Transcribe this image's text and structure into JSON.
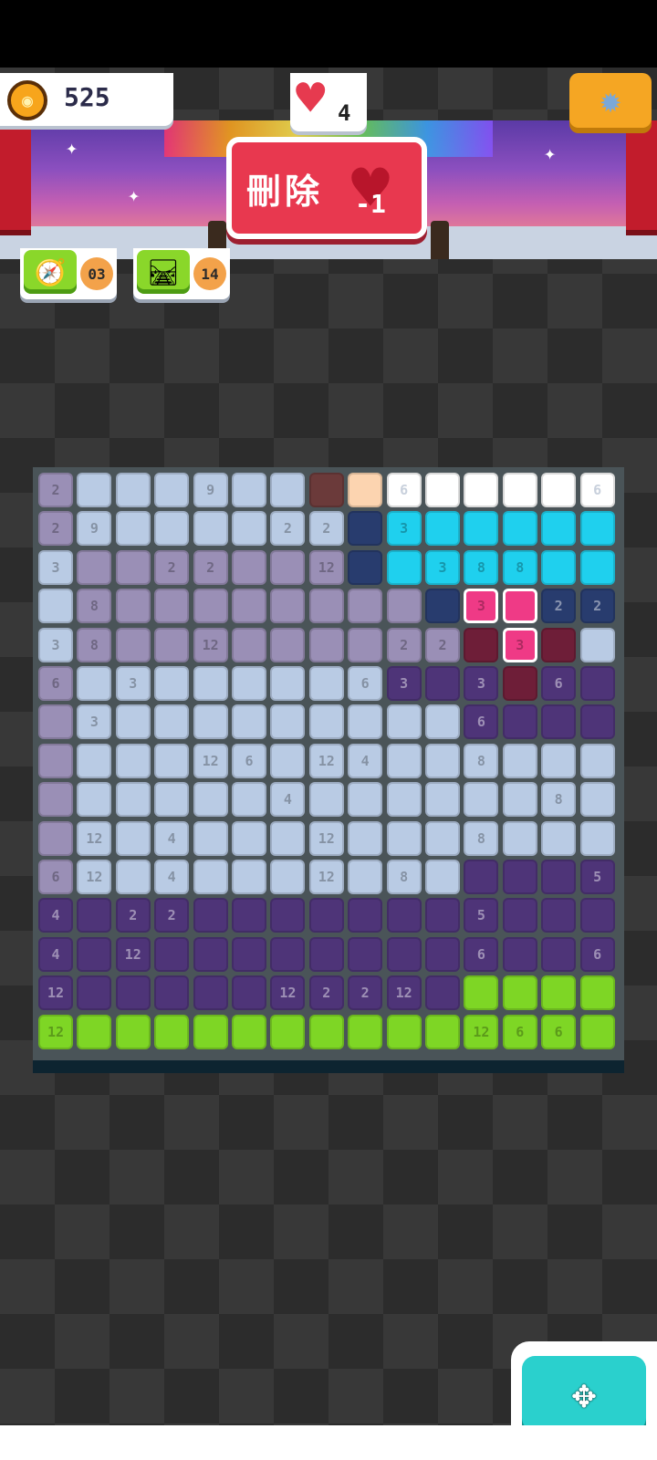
{
  "header": {
    "coins": "525",
    "lives": "4",
    "delete_label": "刪除",
    "delete_cost": "-1",
    "icons": {
      "coin": "coin-icon",
      "heart": "heart-icon",
      "settings": "gear-icon"
    }
  },
  "powerups": [
    {
      "icon": "compass-icon",
      "count": "03"
    },
    {
      "icon": "rail-icon",
      "count": "14"
    }
  ],
  "fab": {
    "icon": "move-arrows-icon"
  },
  "colors": {
    "L": "#b9cbe4",
    "P": "#9a8fb6",
    "D": "#4e3478",
    "G": "#7ed625",
    "C": "#1fd0ee",
    "N": "#283c6e",
    "K": "#ef3a86",
    "M": "#6e1e38",
    "B": "#6b3a3a",
    "E": "#fcd4b0",
    "W": "#ffffff"
  },
  "board": {
    "rows": [
      [
        "P",
        "L",
        "L",
        "L",
        "L",
        "L",
        "L",
        "B",
        "E",
        "W",
        "W",
        "W",
        "W",
        "W",
        "W"
      ],
      [
        "P",
        "L",
        "L",
        "L",
        "L",
        "L",
        "L",
        "L",
        "N",
        "C",
        "C",
        "C",
        "C",
        "C",
        "C"
      ],
      [
        "L",
        "P",
        "P",
        "P",
        "P",
        "P",
        "P",
        "P",
        "N",
        "C",
        "C",
        "C",
        "C",
        "C",
        "C"
      ],
      [
        "L",
        "P",
        "P",
        "P",
        "P",
        "P",
        "P",
        "P",
        "P",
        "P",
        "N",
        "K",
        "K",
        "N",
        "N"
      ],
      [
        "L",
        "P",
        "P",
        "P",
        "P",
        "P",
        "P",
        "P",
        "P",
        "P",
        "P",
        "M",
        "K",
        "M",
        "L"
      ],
      [
        "P",
        "L",
        "L",
        "L",
        "L",
        "L",
        "L",
        "L",
        "L",
        "D",
        "D",
        "D",
        "M",
        "D",
        "D"
      ],
      [
        "P",
        "L",
        "L",
        "L",
        "L",
        "L",
        "L",
        "L",
        "L",
        "L",
        "L",
        "D",
        "D",
        "D",
        "D"
      ],
      [
        "P",
        "L",
        "L",
        "L",
        "L",
        "L",
        "L",
        "L",
        "L",
        "L",
        "L",
        "L",
        "L",
        "L",
        "L"
      ],
      [
        "P",
        "L",
        "L",
        "L",
        "L",
        "L",
        "L",
        "L",
        "L",
        "L",
        "L",
        "L",
        "L",
        "L",
        "L"
      ],
      [
        "P",
        "L",
        "L",
        "L",
        "L",
        "L",
        "L",
        "L",
        "L",
        "L",
        "L",
        "L",
        "L",
        "L",
        "L"
      ],
      [
        "P",
        "L",
        "L",
        "L",
        "L",
        "L",
        "L",
        "L",
        "L",
        "L",
        "L",
        "D",
        "D",
        "D",
        "D"
      ],
      [
        "D",
        "D",
        "D",
        "D",
        "D",
        "D",
        "D",
        "D",
        "D",
        "D",
        "D",
        "D",
        "D",
        "D",
        "D"
      ],
      [
        "D",
        "D",
        "D",
        "D",
        "D",
        "D",
        "D",
        "D",
        "D",
        "D",
        "D",
        "D",
        "D",
        "D",
        "D"
      ],
      [
        "D",
        "D",
        "D",
        "D",
        "D",
        "D",
        "D",
        "D",
        "D",
        "D",
        "D",
        "G",
        "G",
        "G",
        "G"
      ],
      [
        "G",
        "G",
        "G",
        "G",
        "G",
        "G",
        "G",
        "G",
        "G",
        "G",
        "G",
        "G",
        "G",
        "G",
        "G"
      ]
    ],
    "numbers": [
      [
        "2",
        "",
        "",
        "",
        "9",
        "",
        "",
        "",
        "",
        "6",
        "",
        "",
        "",
        "",
        "6"
      ],
      [
        "2",
        "9",
        "",
        "",
        "",
        "",
        "2",
        "2",
        "",
        "3",
        "",
        "",
        "",
        "",
        ""
      ],
      [
        "3",
        "",
        "",
        "2",
        "2",
        "",
        "",
        "12",
        "",
        "",
        "3",
        "8",
        "8",
        "",
        ""
      ],
      [
        "",
        "8",
        "",
        "",
        "",
        "",
        "",
        "",
        "",
        "",
        "",
        "3",
        "",
        "2",
        "2"
      ],
      [
        "3",
        "8",
        "",
        "",
        "12",
        "",
        "",
        "",
        "",
        "2",
        "2",
        "",
        "3",
        "",
        ""
      ],
      [
        "6",
        "",
        "3",
        "",
        "",
        "",
        "",
        "",
        "6",
        "3",
        "",
        "3",
        "",
        "6",
        ""
      ],
      [
        "",
        "3",
        "",
        "",
        "",
        "",
        "",
        "",
        "",
        "",
        "",
        "6",
        "",
        "",
        ""
      ],
      [
        "",
        "",
        "",
        "",
        "12",
        "6",
        "",
        "12",
        "4",
        "",
        "",
        "8",
        "",
        "",
        ""
      ],
      [
        "",
        "",
        "",
        "",
        "",
        "",
        "4",
        "",
        "",
        "",
        "",
        "",
        "",
        "8",
        ""
      ],
      [
        "",
        "12",
        "",
        "4",
        "",
        "",
        "",
        "12",
        "",
        "",
        "",
        "8",
        "",
        "",
        ""
      ],
      [
        "6",
        "12",
        "",
        "4",
        "",
        "",
        "",
        "12",
        "",
        "8",
        "",
        "",
        "",
        "",
        "5"
      ],
      [
        "4",
        "",
        "2",
        "2",
        "",
        "",
        "",
        "",
        "",
        "",
        "",
        "5",
        "",
        "",
        ""
      ],
      [
        "4",
        "",
        "12",
        "",
        "",
        "",
        "",
        "",
        "",
        "",
        "",
        "6",
        "",
        "",
        "6"
      ],
      [
        "12",
        "",
        "",
        "",
        "",
        "",
        "12",
        "2",
        "2",
        "12",
        "",
        "",
        "",
        "",
        ""
      ],
      [
        "12",
        "",
        "",
        "",
        "",
        "",
        "",
        "",
        "",
        "",
        "",
        "12",
        "6",
        "6",
        ""
      ]
    ]
  }
}
